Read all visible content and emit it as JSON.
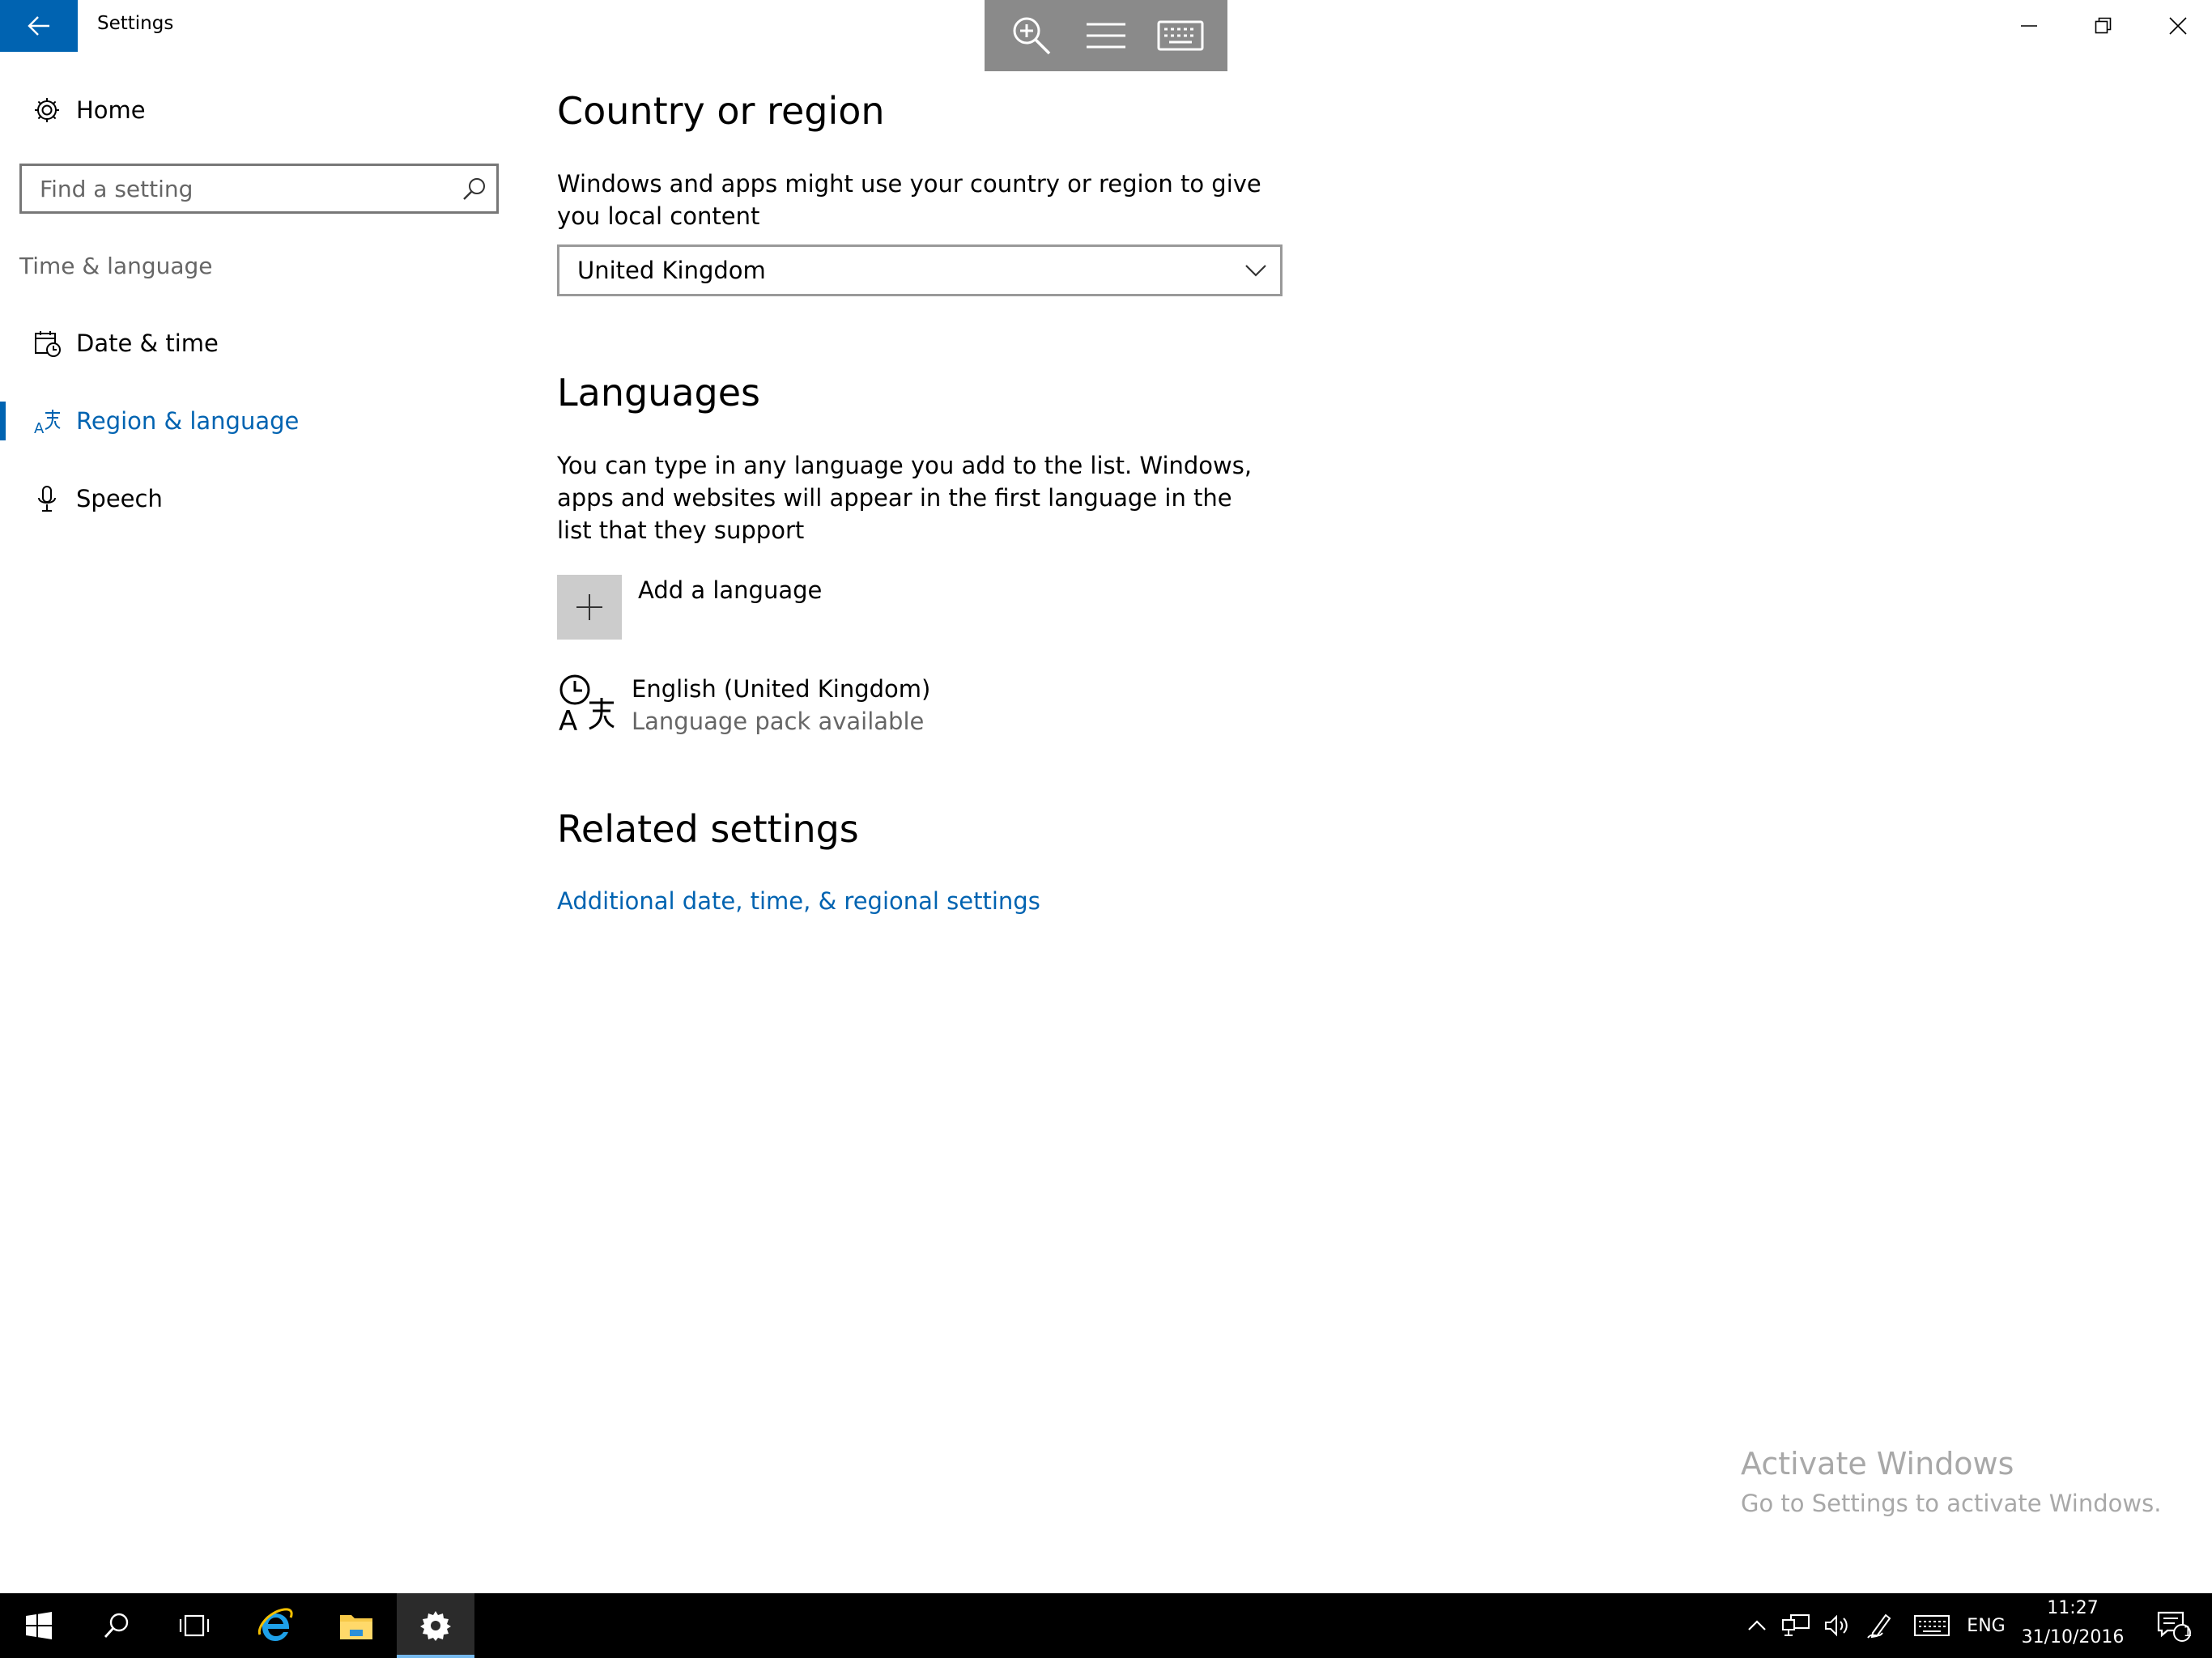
{
  "window": {
    "title": "Settings"
  },
  "sidebar": {
    "home_label": "Home",
    "search_placeholder": "Find a setting",
    "section_label": "Time & language",
    "items": [
      {
        "label": "Date & time",
        "icon": "calendar-clock-icon"
      },
      {
        "label": "Region & language",
        "icon": "region-language-icon",
        "selected": true
      },
      {
        "label": "Speech",
        "icon": "microphone-icon"
      }
    ]
  },
  "country": {
    "heading": "Country or region",
    "description": "Windows and apps might use your country or region to give you local content",
    "selected": "United Kingdom"
  },
  "languages": {
    "heading": "Languages",
    "description": "You can type in any language you add to the list. Windows, apps and websites will appear in the first language in the list that they support",
    "add_label": "Add a language",
    "items": [
      {
        "name": "English (United Kingdom)",
        "status": "Language pack available"
      }
    ]
  },
  "related": {
    "heading": "Related settings",
    "link": "Additional date, time, & regional settings"
  },
  "watermark": {
    "title": "Activate Windows",
    "subtitle": "Go to Settings to activate Windows."
  },
  "taskbar": {
    "language": "ENG",
    "time": "11:27",
    "date": "31/10/2016",
    "notification_count": "1"
  },
  "colors": {
    "accent": "#0063b1",
    "taskbar": "#000000"
  }
}
